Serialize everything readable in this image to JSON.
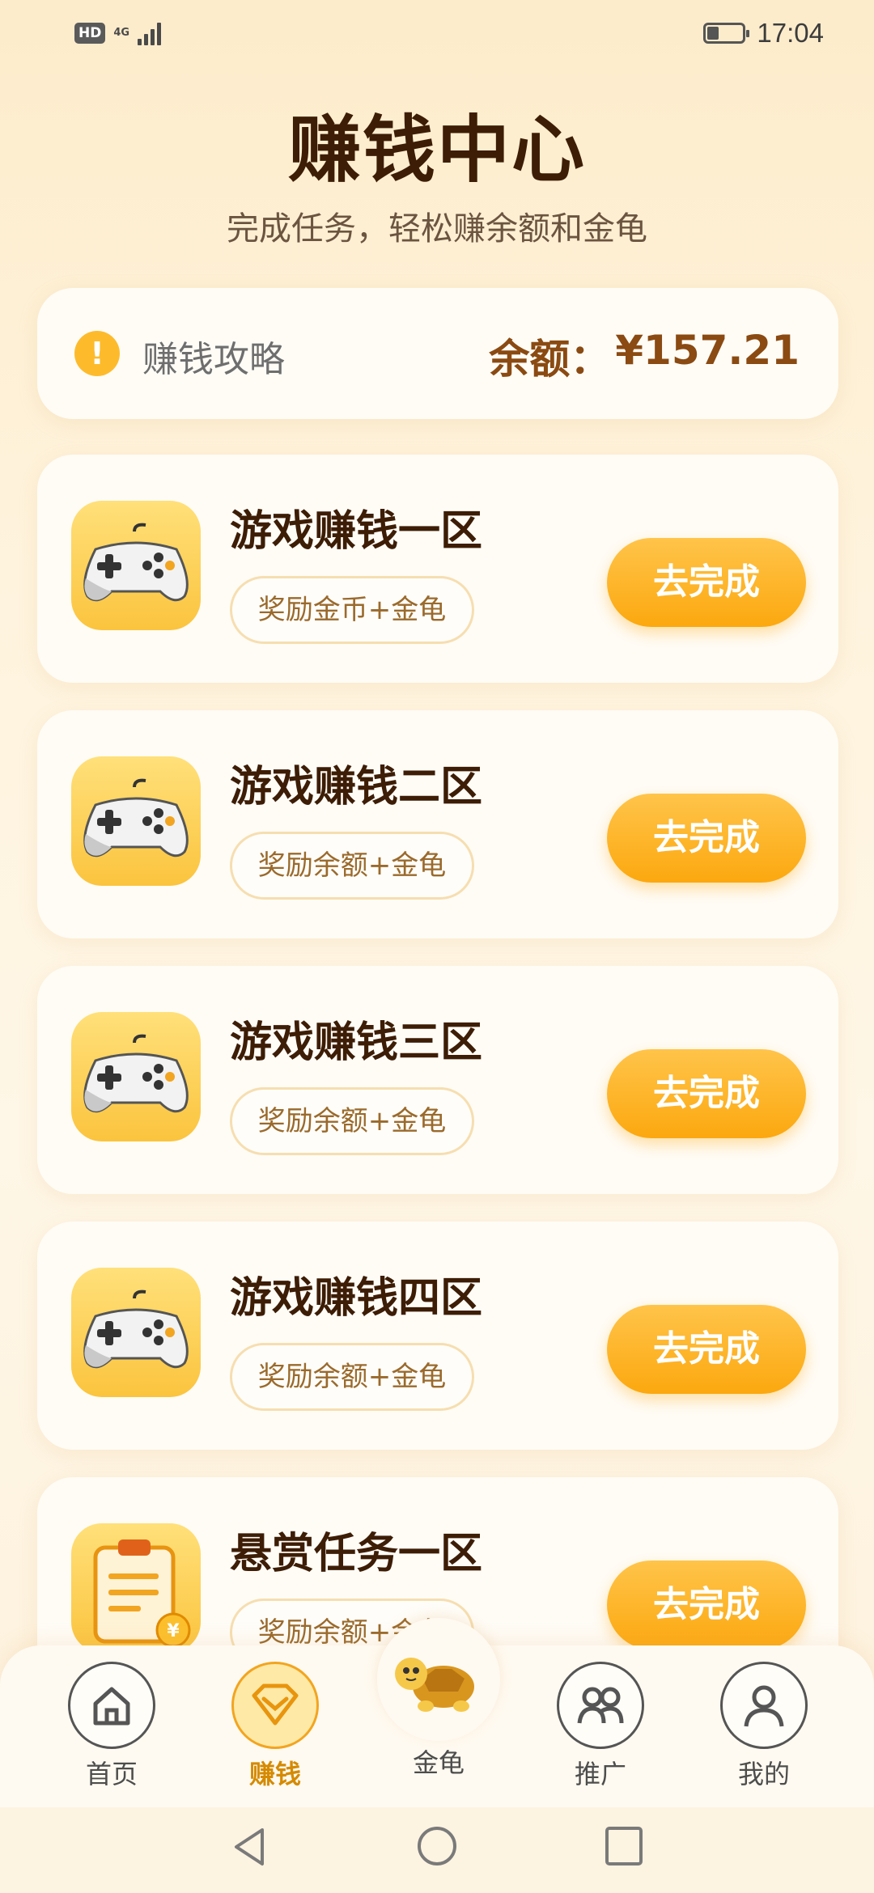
{
  "status_bar": {
    "hd": "HD",
    "network": "4G",
    "time": "17:04"
  },
  "header": {
    "title": "赚钱中心",
    "subtitle": "完成任务，轻松赚余额和金龟"
  },
  "info": {
    "icon_glyph": "!",
    "guide_label": "赚钱攻略",
    "balance_label": "余额：",
    "balance_value": "¥157.21"
  },
  "tasks": [
    {
      "title": "游戏赚钱一区",
      "reward": "奖励金币+金龟",
      "button": "去完成",
      "icon": "gamepad-icon"
    },
    {
      "title": "游戏赚钱二区",
      "reward": "奖励余额+金龟",
      "button": "去完成",
      "icon": "gamepad-icon"
    },
    {
      "title": "游戏赚钱三区",
      "reward": "奖励余额+金龟",
      "button": "去完成",
      "icon": "gamepad-icon"
    },
    {
      "title": "游戏赚钱四区",
      "reward": "奖励余额+金龟",
      "button": "去完成",
      "icon": "gamepad-icon"
    },
    {
      "title": "悬赏任务一区",
      "reward": "奖励余额+金龟",
      "button": "去完成",
      "icon": "clipboard-icon"
    }
  ],
  "bottom_nav": {
    "home": "首页",
    "earn": "赚钱",
    "turtle": "金龟",
    "promote": "推广",
    "mine": "我的",
    "active": "earn"
  },
  "colors": {
    "accent": "#fca80f",
    "title": "#3d1d06",
    "balance": "#8a4a12"
  }
}
